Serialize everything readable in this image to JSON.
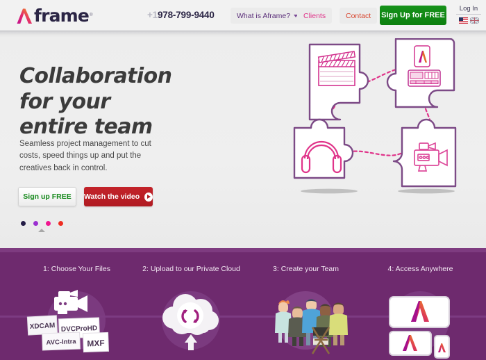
{
  "header": {
    "logo": {
      "mark": "aframe-chevron-logo",
      "text": "frame",
      "registered": "®"
    },
    "phone": {
      "country_code": "+1",
      "number": "978-799-9440"
    },
    "nav": [
      {
        "id": "whatis",
        "label": "What is Aframe?",
        "has_caret": true,
        "color": "#5b2f7a"
      },
      {
        "id": "clients",
        "label": "Clients",
        "has_caret": false,
        "color": "#e0348a"
      },
      {
        "id": "contact",
        "label": "Contact",
        "has_caret": false,
        "color": "#d8452e"
      }
    ],
    "signup_button": {
      "label": "Sign Up for FREE",
      "color": "#0d800f"
    },
    "login": {
      "label": "Log In",
      "flags": [
        "us-flag-icon",
        "uk-flag-icon"
      ]
    }
  },
  "hero": {
    "headline_line1": "Collaboration",
    "headline_line2": "for your",
    "headline_line3": "entire team",
    "subtext": "Seamless project management to cut costs, speed things up and put the creatives back in control.",
    "signup_button": "Sign up FREE",
    "video_button": "Watch the video",
    "carousel_dots": [
      {
        "color": "#241c46",
        "active": true
      },
      {
        "color": "#9b30d0",
        "active": false
      },
      {
        "color": "#f0158f",
        "active": false
      },
      {
        "color": "#ee2d22",
        "active": false
      }
    ],
    "puzzle_pieces": [
      {
        "icon": "clapperboard-icon",
        "position": "top-left"
      },
      {
        "icon": "tablet-editor-icon",
        "position": "top-right"
      },
      {
        "icon": "headphones-icon",
        "position": "bottom-left"
      },
      {
        "icon": "video-camera-icon",
        "position": "bottom-right"
      }
    ]
  },
  "steps": [
    {
      "label": "1: Choose Your Files",
      "icon": "camcorder-icon",
      "formats": [
        "XDCAM",
        "DVCProHD",
        "AVC-Intra",
        "MXF"
      ]
    },
    {
      "label": "2: Upload to our Private Cloud",
      "icon": "cloud-upload-icon"
    },
    {
      "label": "3: Create your Team",
      "icon": "team-group-icon"
    },
    {
      "label": "4: Access Anywhere",
      "icon": "multi-device-icon"
    }
  ],
  "colors": {
    "brand_purple": "#6e2a6e",
    "brand_magenta": "#e0348a",
    "accent_green": "#0d800f",
    "accent_red": "#b01b22"
  }
}
